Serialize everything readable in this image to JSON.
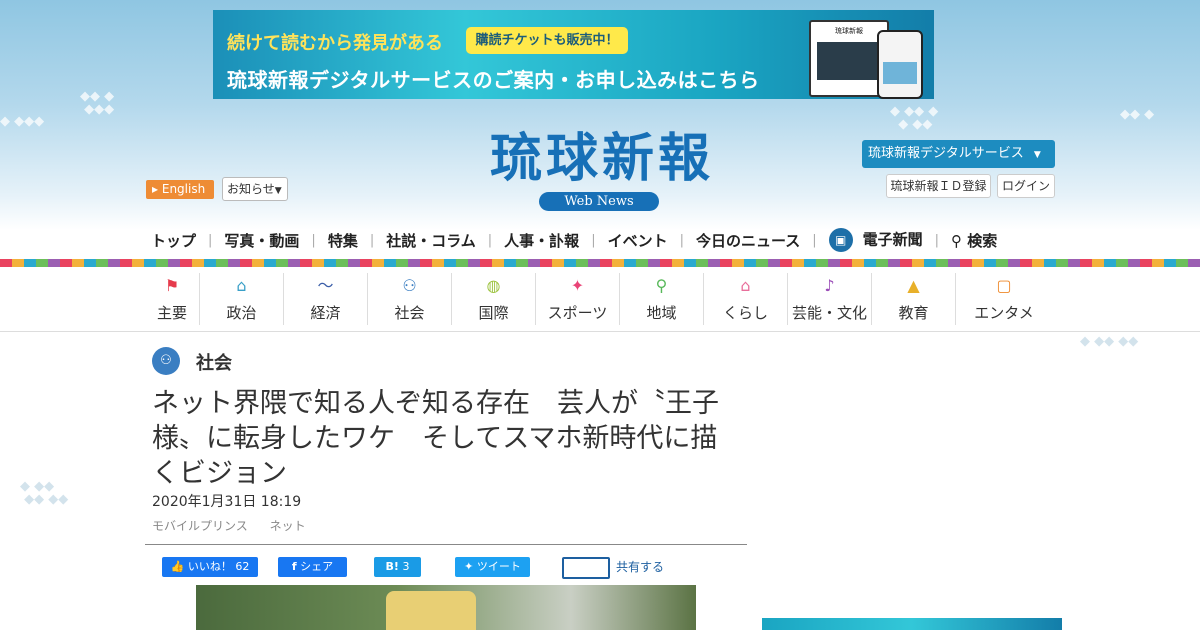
{
  "banner": {
    "catchphrase": "続けて読むから発見がある",
    "badge": "購読チケットも販売中！",
    "main": "琉球新報デジタルサービスのご案内・お申し込みはこちら",
    "device_title": "琉球新報"
  },
  "header": {
    "logo": "琉球新報",
    "logo_sub": "Web News",
    "english_label": "English",
    "notice_label": "お知らせ",
    "digital_service_label": "琉球新報デジタルサービス",
    "id_register_label": "琉球新報ＩＤ登録",
    "login_label": "ログイン"
  },
  "mainnav": {
    "items": [
      "トップ",
      "写真・動画",
      "特集",
      "社説・コラム",
      "人事・訃報",
      "イベント",
      "今日のニュース",
      "電子新聞",
      "検索"
    ]
  },
  "catnav": {
    "items": [
      {
        "label": "主要",
        "icon": "flag-icon",
        "color": "#e63b4c"
      },
      {
        "label": "政治",
        "icon": "parliament-icon",
        "color": "#3aa0c8"
      },
      {
        "label": "経済",
        "icon": "chart-icon",
        "color": "#3b5ea8"
      },
      {
        "label": "社会",
        "icon": "people-icon",
        "color": "#3a7ec2"
      },
      {
        "label": "国際",
        "icon": "globe-icon",
        "color": "#9bc23b"
      },
      {
        "label": "スポーツ",
        "icon": "runner-icon",
        "color": "#e94477"
      },
      {
        "label": "地域",
        "icon": "pin-icon",
        "color": "#58b85a"
      },
      {
        "label": "くらし",
        "icon": "house-icon",
        "color": "#e86f9b"
      },
      {
        "label": "芸能・文化",
        "icon": "sanshin-icon",
        "color": "#9b4db8"
      },
      {
        "label": "教育",
        "icon": "graduation-cap-icon",
        "color": "#e8b02a"
      },
      {
        "label": "エンタメ",
        "icon": "tv-icon",
        "color": "#ef8a2d"
      }
    ]
  },
  "article": {
    "section": "社会",
    "headline": "ネット界隈で知る人ぞ知る存在　芸人が〝王子様〟に転身したワケ　そしてスマホ新時代に描くビジョン",
    "date": "2020年1月31日 18:19",
    "tags": [
      "モバイルプリンス",
      "ネット"
    ]
  },
  "share": {
    "like_label": "いいね！",
    "like_count": "62",
    "facebook_label": "シェア",
    "hatena_label": "B!",
    "hatena_count": "3",
    "tweet_label": "ツイート",
    "mail_label": "共有する"
  }
}
